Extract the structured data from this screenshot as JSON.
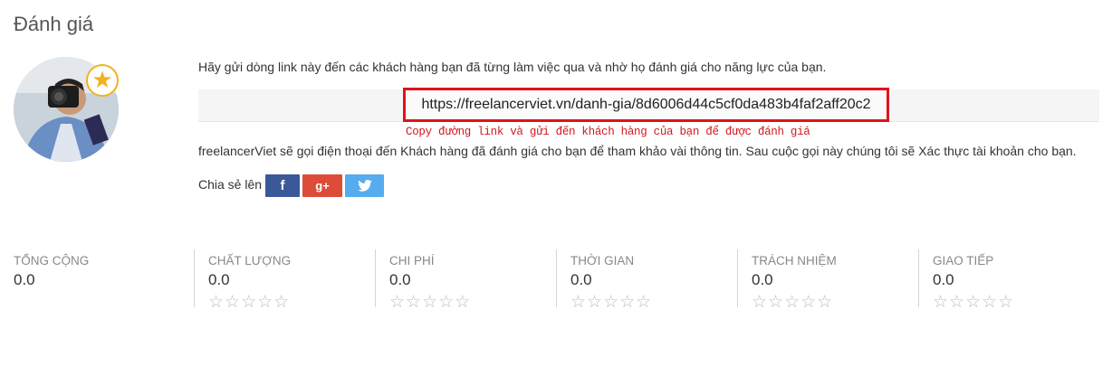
{
  "section": {
    "title": "Đánh giá"
  },
  "badge": {
    "icon": "star-icon"
  },
  "intro_text": "Hãy gửi dòng link này đến các khách hàng bạn đã từng làm việc qua và nhờ họ đánh giá cho năng lực của bạn.",
  "review_link": "https://freelancerviet.vn/danh-gia/8d6006d44c5cf0da483b4faf2aff20c2",
  "copy_hint": "Copy đường link và gửi đến khách hàng của bạn để được đánh giá",
  "note_text": "freelancerViet sẽ gọi điện thoại đến Khách hàng đã đánh giá cho bạn để tham khảo vài thông tin. Sau cuộc gọi này chúng tôi sẽ Xác thực tài khoản cho bạn.",
  "share": {
    "label": "Chia sẻ lên",
    "facebook": "f",
    "google_plus": "g+",
    "twitter_icon": "twitter-bird-icon"
  },
  "colors": {
    "highlight_red": "#e0131a",
    "facebook": "#3b5998",
    "google_plus": "#dd4b39",
    "twitter": "#55acee",
    "star_gold": "#f2b01e"
  },
  "stats": [
    {
      "label": "TỔNG CỘNG",
      "value": "0.0"
    },
    {
      "label": "CHẤT LƯỢNG",
      "value": "0.0",
      "rating": 0
    },
    {
      "label": "CHI PHÍ",
      "value": "0.0",
      "rating": 0
    },
    {
      "label": "THỜI GIAN",
      "value": "0.0",
      "rating": 0
    },
    {
      "label": "TRÁCH NHIỆM",
      "value": "0.0",
      "rating": 0
    },
    {
      "label": "GIAO TIẾP",
      "value": "0.0",
      "rating": 0
    }
  ]
}
